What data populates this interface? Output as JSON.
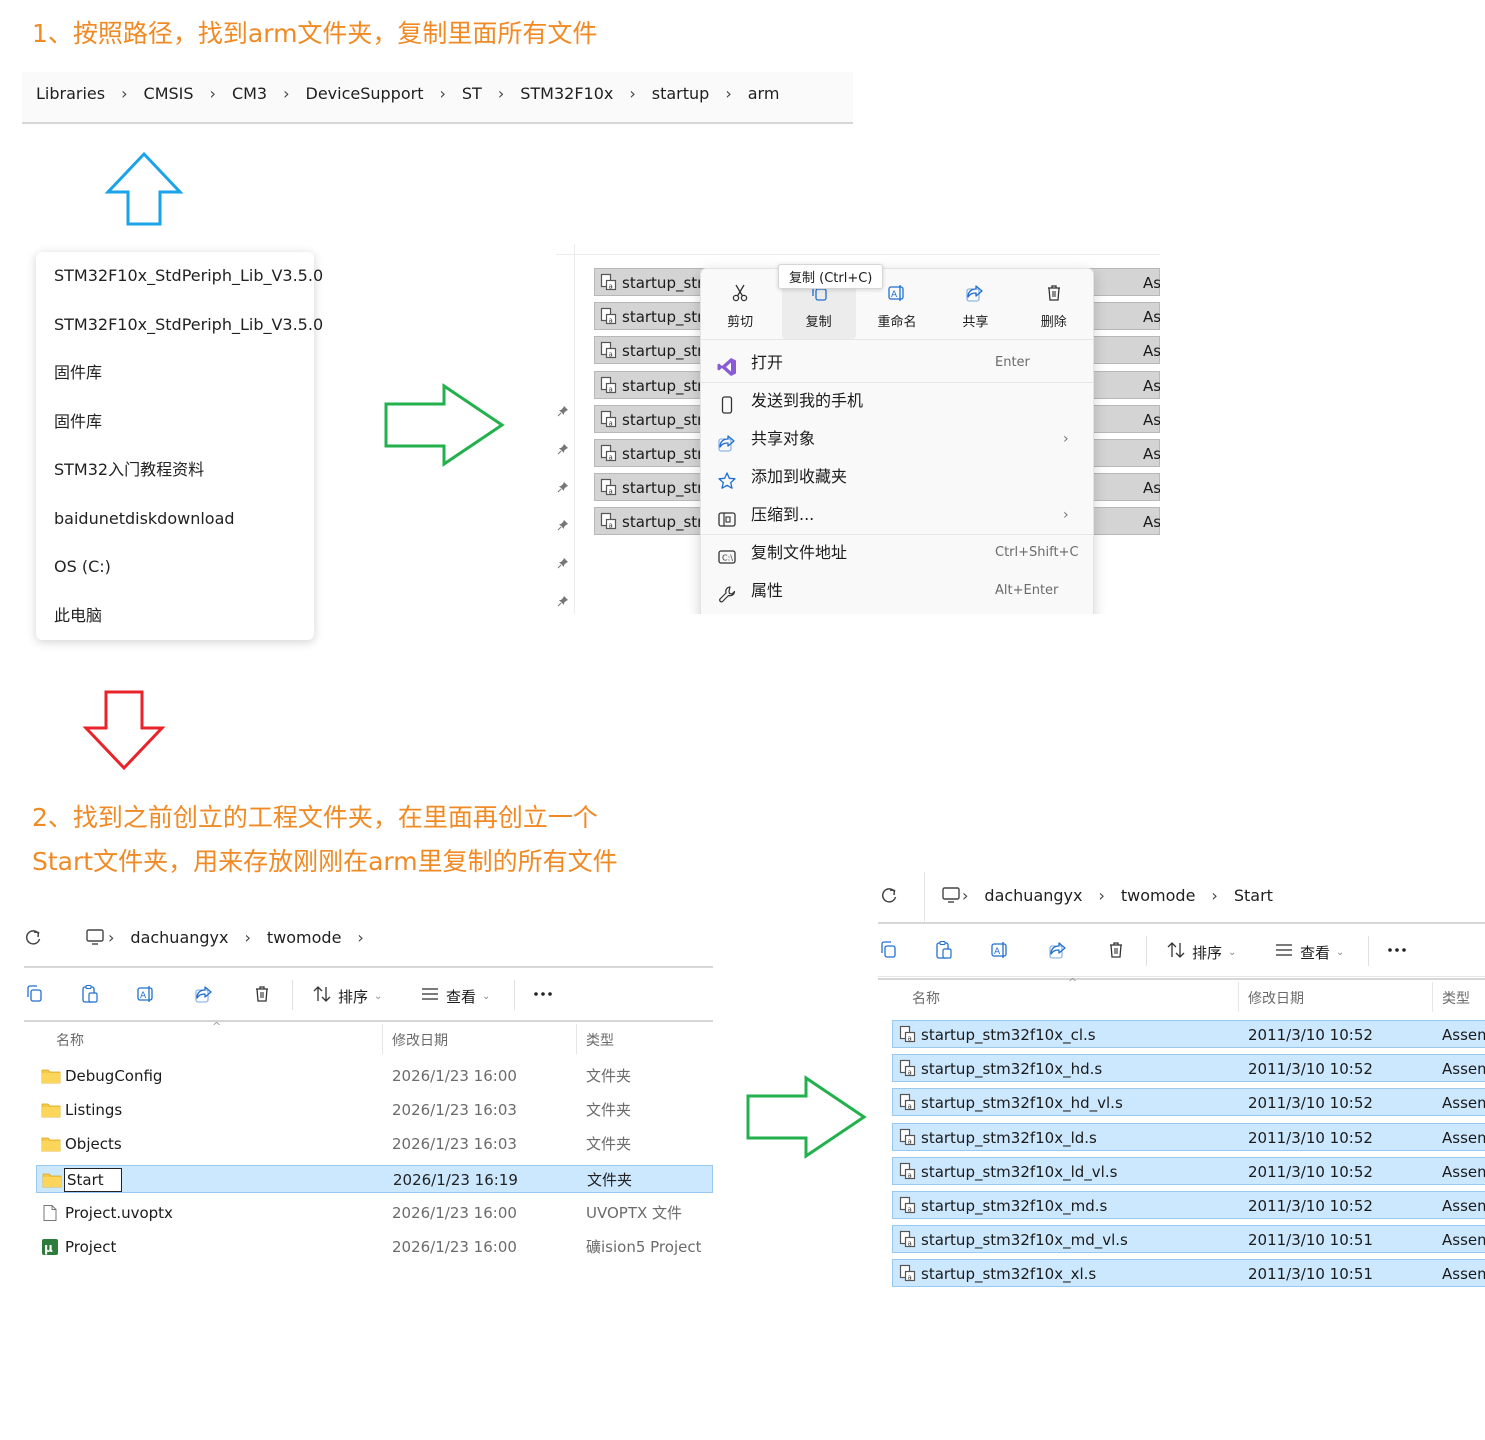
{
  "step1": {
    "title": "1、按照路径，找到arm文件夹，复制里面所有文件",
    "breadcrumb": [
      "Libraries",
      "CMSIS",
      "CM3",
      "DeviceSupport",
      "ST",
      "STM32F10x",
      "startup",
      "arm"
    ]
  },
  "recent_list": [
    "STM32F10x_StdPeriph_Lib_V3.5.0",
    "STM32F10x_StdPeriph_Lib_V3.5.0",
    "固件库",
    "固件库",
    "STM32入门教程资料",
    "baidunetdiskdownload",
    "OS (C:)",
    "此电脑"
  ],
  "context": {
    "row_label": "startup_stm",
    "type_label": "As",
    "tooltip": "复制 (Ctrl+C)",
    "top_buttons": [
      {
        "label": "剪切",
        "icon": "cut-icon"
      },
      {
        "label": "复制",
        "icon": "copy-icon"
      },
      {
        "label": "重命名",
        "icon": "rename-icon"
      },
      {
        "label": "共享",
        "icon": "share-icon"
      },
      {
        "label": "删除",
        "icon": "delete-icon"
      }
    ],
    "menu_items": [
      {
        "label": "打开",
        "shortcut": "Enter",
        "icon": "visual-studio-icon"
      },
      {
        "label": "发送到我的手机",
        "shortcut": "",
        "icon": "phone-icon"
      },
      {
        "label": "共享对象",
        "shortcut": "",
        "icon": "share-icon",
        "submenu": true
      },
      {
        "label": "添加到收藏夹",
        "shortcut": "",
        "icon": "star-icon"
      },
      {
        "label": "压缩到...",
        "shortcut": "",
        "icon": "zip-icon",
        "submenu": true
      },
      {
        "label": "复制文件地址",
        "shortcut": "Ctrl+Shift+C",
        "icon": "path-icon"
      },
      {
        "label": "属性",
        "shortcut": "Alt+Enter",
        "icon": "wrench-icon"
      }
    ]
  },
  "step2": {
    "title_line1": "2、找到之前创立的工程文件夹，在里面再创立一个",
    "title_line2": "Start文件夹，用来存放刚刚在arm里复制的所有文件"
  },
  "explorer_left": {
    "breadcrumb": [
      "dachuangyx",
      "twomode"
    ],
    "toolbar": {
      "sort": "排序",
      "view": "查看"
    },
    "headers": {
      "name": "名称",
      "date": "修改日期",
      "type": "类型"
    },
    "rows": [
      {
        "name": "DebugConfig",
        "date": "2026/1/23 16:00",
        "type": "文件夹",
        "icon": "folder-icon"
      },
      {
        "name": "Listings",
        "date": "2026/1/23 16:03",
        "type": "文件夹",
        "icon": "folder-icon"
      },
      {
        "name": "Objects",
        "date": "2026/1/23 16:03",
        "type": "文件夹",
        "icon": "folder-icon"
      },
      {
        "name": "Start",
        "date": "2026/1/23 16:19",
        "type": "文件夹",
        "icon": "folder-icon",
        "selected": true
      },
      {
        "name": "Project.uvoptx",
        "date": "2026/1/23 16:00",
        "type": "UVOPTX 文件",
        "icon": "file-icon"
      },
      {
        "name": "Project",
        "date": "2026/1/23 16:00",
        "type": "礦ision5 Project",
        "icon": "keil-project-icon"
      }
    ]
  },
  "explorer_right": {
    "breadcrumb": [
      "dachuangyx",
      "twomode",
      "Start"
    ],
    "toolbar": {
      "sort": "排序",
      "view": "查看"
    },
    "headers": {
      "name": "名称",
      "date": "修改日期",
      "type": "类型"
    },
    "rows": [
      {
        "name": "startup_stm32f10x_cl.s",
        "date": "2011/3/10 10:52",
        "type": "Assem"
      },
      {
        "name": "startup_stm32f10x_hd.s",
        "date": "2011/3/10 10:52",
        "type": "Assem"
      },
      {
        "name": "startup_stm32f10x_hd_vl.s",
        "date": "2011/3/10 10:52",
        "type": "Assem"
      },
      {
        "name": "startup_stm32f10x_ld.s",
        "date": "2011/3/10 10:52",
        "type": "Assem"
      },
      {
        "name": "startup_stm32f10x_ld_vl.s",
        "date": "2011/3/10 10:52",
        "type": "Assem"
      },
      {
        "name": "startup_stm32f10x_md.s",
        "date": "2011/3/10 10:52",
        "type": "Assem"
      },
      {
        "name": "startup_stm32f10x_md_vl.s",
        "date": "2011/3/10 10:51",
        "type": "Assem"
      },
      {
        "name": "startup_stm32f10x_xl.s",
        "date": "2011/3/10 10:51",
        "type": "Assem"
      }
    ]
  },
  "colors": {
    "title_orange": "#f08a24",
    "arrow_blue": "#1aa3e8",
    "arrow_green": "#22b14c",
    "arrow_red": "#e8232a",
    "selection": "#cce8ff"
  }
}
